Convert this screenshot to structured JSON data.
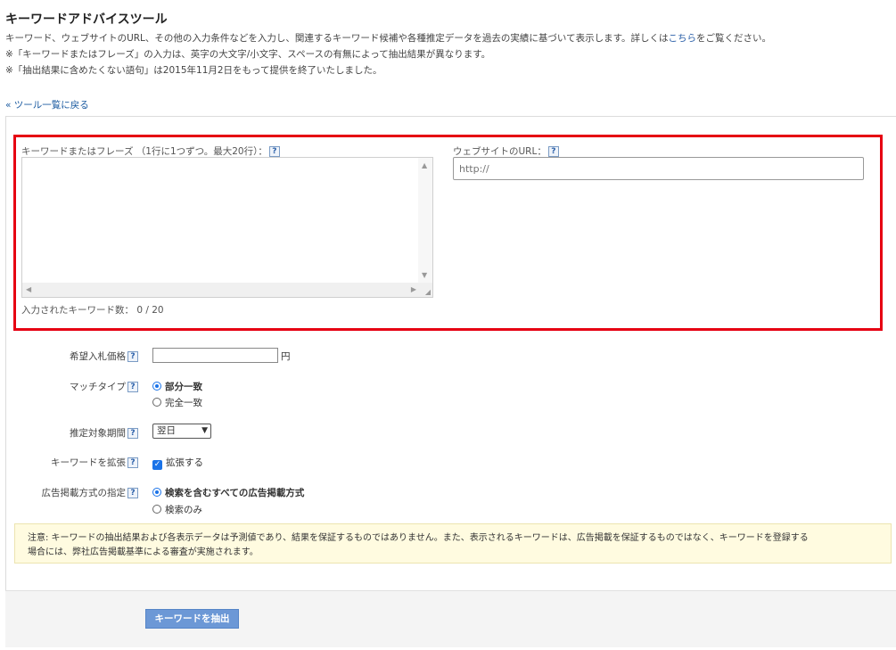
{
  "header": {
    "title": "キーワードアドバイスツール",
    "desc_line1_prefix": "キーワード、ウェブサイトのURL、その他の入力条件などを入力し、関連するキーワード候補や各種推定データを過去の実績に基づいて表示します。詳しくは",
    "desc_line1_link": "こちら",
    "desc_line1_suffix": "をご覧ください。",
    "desc_line2": "※「キーワードまたはフレーズ」の入力は、英字の大文字/小文字、スペースの有無によって抽出結果が異なります。",
    "desc_line3": "※「抽出結果に含めたくない語句」は2015年11月2日をもって提供を終了いたしました。",
    "back_link": "« ツール一覧に戻る"
  },
  "keywords": {
    "label": "キーワードまたはフレーズ （1行に1つずつ。最大20行）：",
    "value": "",
    "count_label": "入力されたキーワード数： 0 / 20"
  },
  "url": {
    "label": "ウェブサイトのURL：",
    "placeholder": "http://"
  },
  "bid": {
    "label": "希望入札価格",
    "value": "",
    "unit": "円"
  },
  "match_type": {
    "label": "マッチタイプ",
    "options": [
      "部分一致",
      "完全一致"
    ],
    "selected": "部分一致"
  },
  "period": {
    "label": "推定対象期間",
    "selected": "翌日"
  },
  "expand": {
    "label": "キーワードを拡張",
    "checkbox_label": "拡張する",
    "checked": true
  },
  "ad_format": {
    "label": "広告掲載方式の指定",
    "options": [
      "検索を含むすべての広告掲載方式",
      "検索のみ"
    ],
    "selected": "検索を含むすべての広告掲載方式"
  },
  "notice": {
    "line1": "注意: キーワードの抽出結果および各表示データは予測値であり、結果を保証するものではありません。また、表示されるキーワードは、広告掲載を保証するものではなく、キーワードを登録する",
    "line2": "場合には、弊社広告掲載基準による審査が実施されます。"
  },
  "submit": {
    "label": "キーワードを抽出"
  },
  "icons": {
    "help": "?",
    "check": "✓",
    "chevron": "▼",
    "scroll_up": "▲",
    "scroll_down": "▼",
    "scroll_left": "◀",
    "scroll_right": "▶",
    "resize": "◢"
  },
  "colors": {
    "highlight_border": "#e60012",
    "accent": "#1a73e8",
    "button": "#6c98d6",
    "notice_bg": "#fffbe0"
  }
}
